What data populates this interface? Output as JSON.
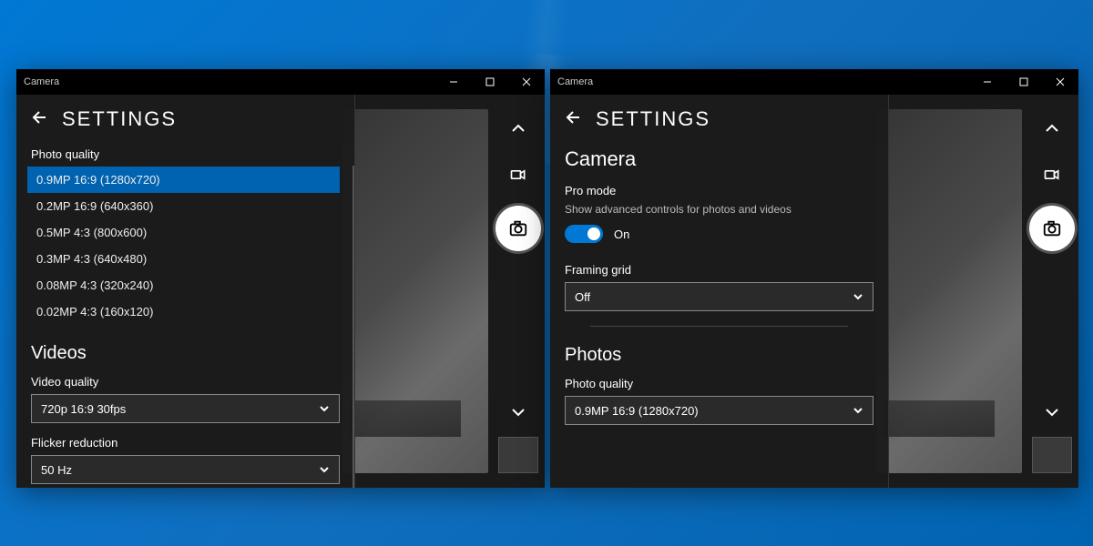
{
  "app_title": "Camera",
  "settings_title": "SETTINGS",
  "left_panel": {
    "photo_quality_label": "Photo quality",
    "quality_options": [
      "0.9MP 16:9 (1280x720)",
      "0.2MP 16:9 (640x360)",
      "0.5MP 4:3 (800x600)",
      "0.3MP 4:3 (640x480)",
      "0.08MP 4:3 (320x240)",
      "0.02MP 4:3 (160x120)"
    ],
    "selected_index": 0,
    "videos_heading": "Videos",
    "video_quality_label": "Video quality",
    "video_quality_value": "720p 16:9 30fps",
    "flicker_label": "Flicker reduction",
    "flicker_value": "50 Hz"
  },
  "right_panel": {
    "camera_heading": "Camera",
    "pro_mode_label": "Pro mode",
    "pro_mode_desc": "Show advanced controls for photos and videos",
    "pro_mode_state": "On",
    "framing_label": "Framing grid",
    "framing_value": "Off",
    "photos_heading": "Photos",
    "photo_quality_label": "Photo quality",
    "photo_quality_value": "0.9MP 16:9 (1280x720)"
  }
}
